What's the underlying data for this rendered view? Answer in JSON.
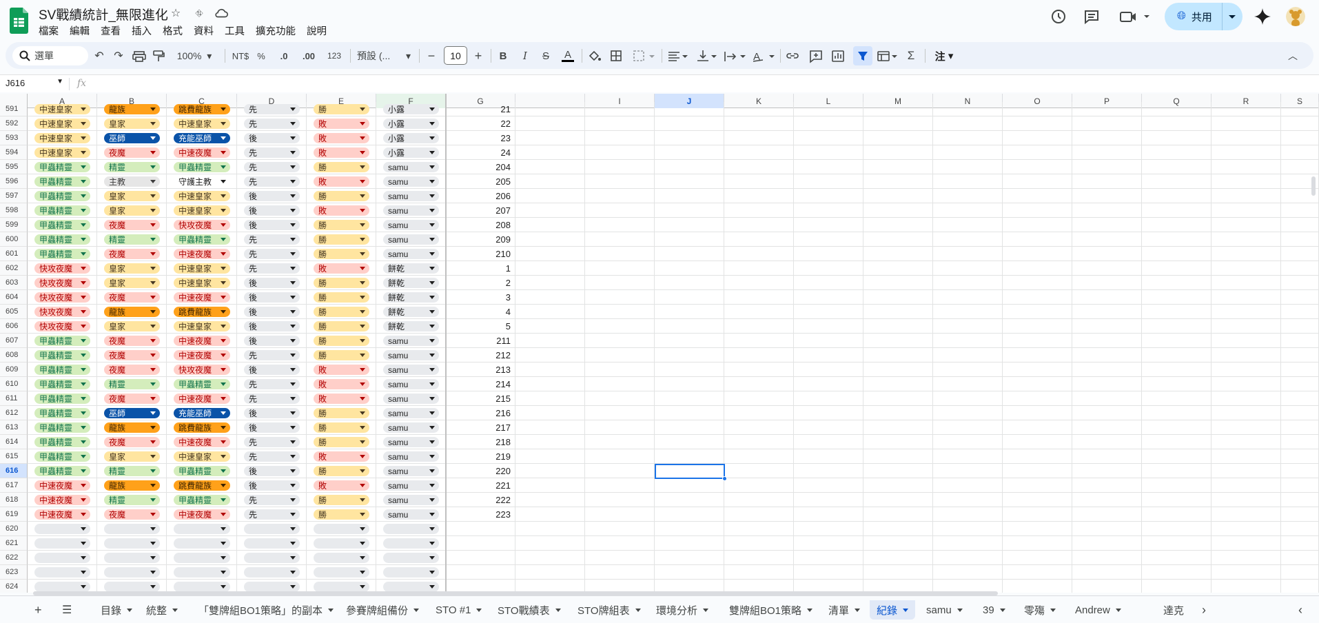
{
  "app": {
    "title": "SV戰績統計_無限進化",
    "menu": [
      "檔案",
      "編輯",
      "查看",
      "插入",
      "格式",
      "資料",
      "工具",
      "擴充功能",
      "說明"
    ],
    "share_label": "共用",
    "colors": {
      "accent": "#1a73e8",
      "share_bg": "#c2e7ff",
      "toolbar_bg": "#edf2fa"
    }
  },
  "toolbar": {
    "search_label": "選單",
    "zoom": "100%",
    "currency": "NT$",
    "percent": "%",
    "dec_dec": ".0",
    "dec_inc": ".00",
    "number_fmt": "123",
    "font": "預設 (...",
    "font_size": "10",
    "annotate": "注",
    "icons": [
      "undo-icon",
      "redo-icon",
      "print-icon",
      "paint-format-icon",
      "bold-icon",
      "italic-icon",
      "strikethrough-icon",
      "text-color-icon",
      "fill-color-icon",
      "borders-icon",
      "merge-icon",
      "align-icon",
      "valign-icon",
      "wrap-icon",
      "rotate-icon",
      "link-icon",
      "comment-icon",
      "chart-icon",
      "filter-icon",
      "filter-views-icon",
      "functions-icon"
    ]
  },
  "formula_bar": {
    "name_box": "J616",
    "fx": "fx",
    "value": ""
  },
  "columns": [
    "A",
    "B",
    "C",
    "D",
    "E",
    "F",
    "G",
    "",
    "I",
    "J",
    "K",
    "L",
    "M",
    "N",
    "O",
    "P",
    "Q",
    "R",
    "S"
  ],
  "rows": [
    {
      "n": "591",
      "a": "中速皇家",
      "b": "龍族",
      "c": "跳費龍族",
      "d": "先",
      "e": "勝",
      "f": "小露",
      "g": "21"
    },
    {
      "n": "592",
      "a": "中速皇家",
      "b": "皇家",
      "c": "中速皇家",
      "d": "先",
      "e": "敗",
      "f": "小露",
      "g": "22"
    },
    {
      "n": "593",
      "a": "中速皇家",
      "b": "巫師",
      "c": "充能巫師",
      "d": "後",
      "e": "敗",
      "f": "小露",
      "g": "23"
    },
    {
      "n": "594",
      "a": "中速皇家",
      "b": "夜魔",
      "c": "中速夜魔",
      "d": "先",
      "e": "敗",
      "f": "小露",
      "g": "24"
    },
    {
      "n": "595",
      "a": "甲蟲精靈",
      "b": "精靈",
      "c": "甲蟲精靈",
      "d": "先",
      "e": "勝",
      "f": "samu",
      "g": "204"
    },
    {
      "n": "596",
      "a": "甲蟲精靈",
      "b": "主教",
      "c": "守護主教",
      "d": "先",
      "e": "敗",
      "f": "samu",
      "g": "205"
    },
    {
      "n": "597",
      "a": "甲蟲精靈",
      "b": "皇家",
      "c": "中速皇家",
      "d": "後",
      "e": "勝",
      "f": "samu",
      "g": "206"
    },
    {
      "n": "598",
      "a": "甲蟲精靈",
      "b": "皇家",
      "c": "中速皇家",
      "d": "後",
      "e": "敗",
      "f": "samu",
      "g": "207"
    },
    {
      "n": "599",
      "a": "甲蟲精靈",
      "b": "夜魔",
      "c": "快攻夜魔",
      "d": "後",
      "e": "勝",
      "f": "samu",
      "g": "208"
    },
    {
      "n": "600",
      "a": "甲蟲精靈",
      "b": "精靈",
      "c": "甲蟲精靈",
      "d": "先",
      "e": "勝",
      "f": "samu",
      "g": "209"
    },
    {
      "n": "601",
      "a": "甲蟲精靈",
      "b": "夜魔",
      "c": "中速夜魔",
      "d": "先",
      "e": "勝",
      "f": "samu",
      "g": "210"
    },
    {
      "n": "602",
      "a": "快攻夜魔",
      "b": "皇家",
      "c": "中速皇家",
      "d": "先",
      "e": "敗",
      "f": "餅乾",
      "g": "1"
    },
    {
      "n": "603",
      "a": "快攻夜魔",
      "b": "皇家",
      "c": "中速皇家",
      "d": "後",
      "e": "勝",
      "f": "餅乾",
      "g": "2"
    },
    {
      "n": "604",
      "a": "快攻夜魔",
      "b": "夜魔",
      "c": "中速夜魔",
      "d": "後",
      "e": "勝",
      "f": "餅乾",
      "g": "3"
    },
    {
      "n": "605",
      "a": "快攻夜魔",
      "b": "龍族",
      "c": "跳費龍族",
      "d": "後",
      "e": "勝",
      "f": "餅乾",
      "g": "4"
    },
    {
      "n": "606",
      "a": "快攻夜魔",
      "b": "皇家",
      "c": "中速皇家",
      "d": "後",
      "e": "勝",
      "f": "餅乾",
      "g": "5"
    },
    {
      "n": "607",
      "a": "甲蟲精靈",
      "b": "夜魔",
      "c": "中速夜魔",
      "d": "後",
      "e": "勝",
      "f": "samu",
      "g": "211"
    },
    {
      "n": "608",
      "a": "甲蟲精靈",
      "b": "夜魔",
      "c": "中速夜魔",
      "d": "先",
      "e": "勝",
      "f": "samu",
      "g": "212"
    },
    {
      "n": "609",
      "a": "甲蟲精靈",
      "b": "夜魔",
      "c": "快攻夜魔",
      "d": "後",
      "e": "敗",
      "f": "samu",
      "g": "213"
    },
    {
      "n": "610",
      "a": "甲蟲精靈",
      "b": "精靈",
      "c": "甲蟲精靈",
      "d": "先",
      "e": "敗",
      "f": "samu",
      "g": "214"
    },
    {
      "n": "611",
      "a": "甲蟲精靈",
      "b": "夜魔",
      "c": "中速夜魔",
      "d": "先",
      "e": "敗",
      "f": "samu",
      "g": "215"
    },
    {
      "n": "612",
      "a": "甲蟲精靈",
      "b": "巫師",
      "c": "充能巫師",
      "d": "後",
      "e": "勝",
      "f": "samu",
      "g": "216"
    },
    {
      "n": "613",
      "a": "甲蟲精靈",
      "b": "龍族",
      "c": "跳費龍族",
      "d": "後",
      "e": "勝",
      "f": "samu",
      "g": "217"
    },
    {
      "n": "614",
      "a": "甲蟲精靈",
      "b": "夜魔",
      "c": "中速夜魔",
      "d": "先",
      "e": "勝",
      "f": "samu",
      "g": "218"
    },
    {
      "n": "615",
      "a": "甲蟲精靈",
      "b": "皇家",
      "c": "中速皇家",
      "d": "先",
      "e": "敗",
      "f": "samu",
      "g": "219"
    },
    {
      "n": "616",
      "a": "甲蟲精靈",
      "b": "精靈",
      "c": "甲蟲精靈",
      "d": "後",
      "e": "勝",
      "f": "samu",
      "g": "220"
    },
    {
      "n": "617",
      "a": "中速夜魔",
      "b": "龍族",
      "c": "跳費龍族",
      "d": "後",
      "e": "敗",
      "f": "samu",
      "g": "221"
    },
    {
      "n": "618",
      "a": "中速夜魔",
      "b": "精靈",
      "c": "甲蟲精靈",
      "d": "先",
      "e": "勝",
      "f": "samu",
      "g": "222"
    },
    {
      "n": "619",
      "a": "中速夜魔",
      "b": "夜魔",
      "c": "中速夜魔",
      "d": "先",
      "e": "勝",
      "f": "samu",
      "g": "223"
    },
    {
      "n": "620",
      "a": "",
      "b": "",
      "c": "",
      "d": "",
      "e": "",
      "f": "",
      "g": ""
    },
    {
      "n": "621",
      "a": "",
      "b": "",
      "c": "",
      "d": "",
      "e": "",
      "f": "",
      "g": ""
    },
    {
      "n": "622",
      "a": "",
      "b": "",
      "c": "",
      "d": "",
      "e": "",
      "f": "",
      "g": ""
    },
    {
      "n": "623",
      "a": "",
      "b": "",
      "c": "",
      "d": "",
      "e": "",
      "f": "",
      "g": ""
    },
    {
      "n": "624",
      "a": "",
      "b": "",
      "c": "",
      "d": "",
      "e": "",
      "f": "",
      "g": ""
    }
  ],
  "chip_colors": {
    "中速皇家": [
      "#ffe5a0",
      "#473821"
    ],
    "甲蟲精靈": [
      "#d4edbc",
      "#11734b"
    ],
    "快攻夜魔": [
      "#ffcfc9",
      "#b10202"
    ],
    "中速夜魔": [
      "#ffcfc9",
      "#b10202"
    ],
    "皇家": [
      "#ffe5a0",
      "#473821"
    ],
    "巫師": [
      "#0a53a8",
      "#ffffff"
    ],
    "夜魔": [
      "#ffcfc9",
      "#b10202"
    ],
    "精靈": [
      "#d4edbc",
      "#11734b"
    ],
    "主教": [
      "#e6e6e6",
      "#3d3d3d"
    ],
    "龍族": [
      "#ffa11a",
      "#3d2300"
    ],
    "充能巫師": [
      "#0a53a8",
      "#ffffff"
    ],
    "跳費龍族": [
      "#ffa11a",
      "#3d2300"
    ],
    "守護主教": [
      "#ffffff",
      "#1f1f1f"
    ],
    "勝": [
      "#ffe5a0",
      "#473821"
    ],
    "敗": [
      "#ffcfc9",
      "#b10202"
    ],
    "": [
      "#e8eaed",
      "#1f1f1f"
    ]
  },
  "sheet_tabs": [
    "目錄",
    "統整",
    "「雙牌組BO1策略」的副本",
    "參賽牌組備份",
    "STO #1",
    "STO戰績表",
    "STO牌組表",
    "環境分析",
    "雙牌組BO1策略",
    "清單",
    "紀錄",
    "samu",
    "39",
    "零殤",
    "Andrew",
    "達克"
  ],
  "active_tab": "紀錄"
}
